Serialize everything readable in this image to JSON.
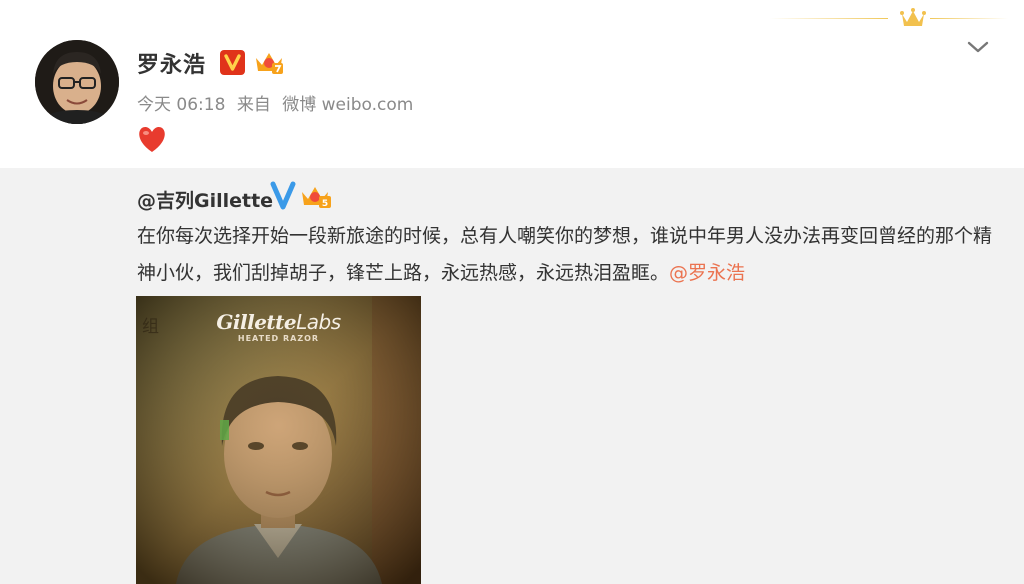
{
  "post": {
    "username": "罗永浩",
    "time": "今天 06:18",
    "source_prefix": "来自",
    "source": "微博 weibo.com"
  },
  "repost": {
    "username": "@吉列Gillette",
    "text": "在你每次选择开始一段新旅途的时候，总有人嘲笑你的梦想，谁说中年男人没办法再变回曾经的那个精神小伙，我们刮掉胡子，锋芒上路，永远热感，永远热泪盈眶。",
    "mention": "@罗永浩",
    "image": {
      "brand": "Gillette",
      "brand_suffix": "Labs",
      "subtitle": "HEATED RAZOR",
      "corner_text": "组"
    }
  },
  "colors": {
    "accent_orange": "#eb7350",
    "verified_red": "#e0331a",
    "verified_blue": "#3b9ae8",
    "repost_bg": "#f2f2f2"
  },
  "icons": [
    "vip-verified-icon",
    "crown-level-icon",
    "chevron-down-icon",
    "heart-icon",
    "blue-verified-icon"
  ]
}
